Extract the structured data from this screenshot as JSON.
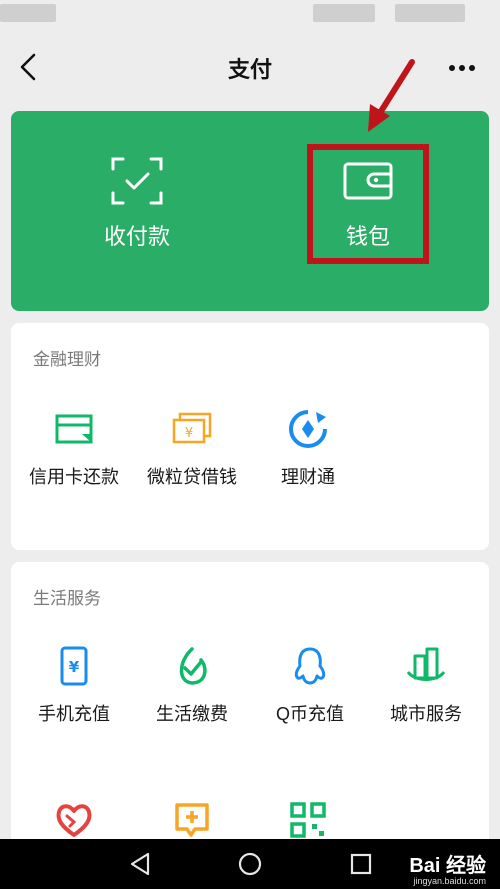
{
  "header": {
    "title": "支付",
    "back_icon": "chevron-left-icon",
    "more_icon": "more-dots-icon"
  },
  "wallet_card": {
    "bg_color": "#2aae67",
    "items": [
      {
        "label": "收付款",
        "icon": "scan-check-icon"
      },
      {
        "label": "钱包",
        "icon": "wallet-icon"
      }
    ],
    "highlight_color": "#c0141b"
  },
  "finance": {
    "title": "金融理财",
    "items": [
      {
        "label": "信用卡还款",
        "icon": "credit-card-icon"
      },
      {
        "label": "微粒贷借钱",
        "icon": "yuan-cards-icon"
      },
      {
        "label": "理财通",
        "icon": "licaitong-icon"
      }
    ]
  },
  "life": {
    "title": "生活服务",
    "items": [
      {
        "label": "手机充值",
        "icon": "phone-yuan-icon"
      },
      {
        "label": "生活缴费",
        "icon": "leaf-check-icon"
      },
      {
        "label": "Q币充值",
        "icon": "qq-penguin-icon"
      },
      {
        "label": "城市服务",
        "icon": "city-buildings-icon"
      },
      {
        "label": "",
        "icon": "heart-charity-icon"
      },
      {
        "label": "",
        "icon": "medical-plus-icon"
      },
      {
        "label": "",
        "icon": "qr-grid-icon"
      }
    ]
  },
  "watermark": {
    "text": "Bai 经验",
    "sub": "jingyan.baidu.com"
  }
}
